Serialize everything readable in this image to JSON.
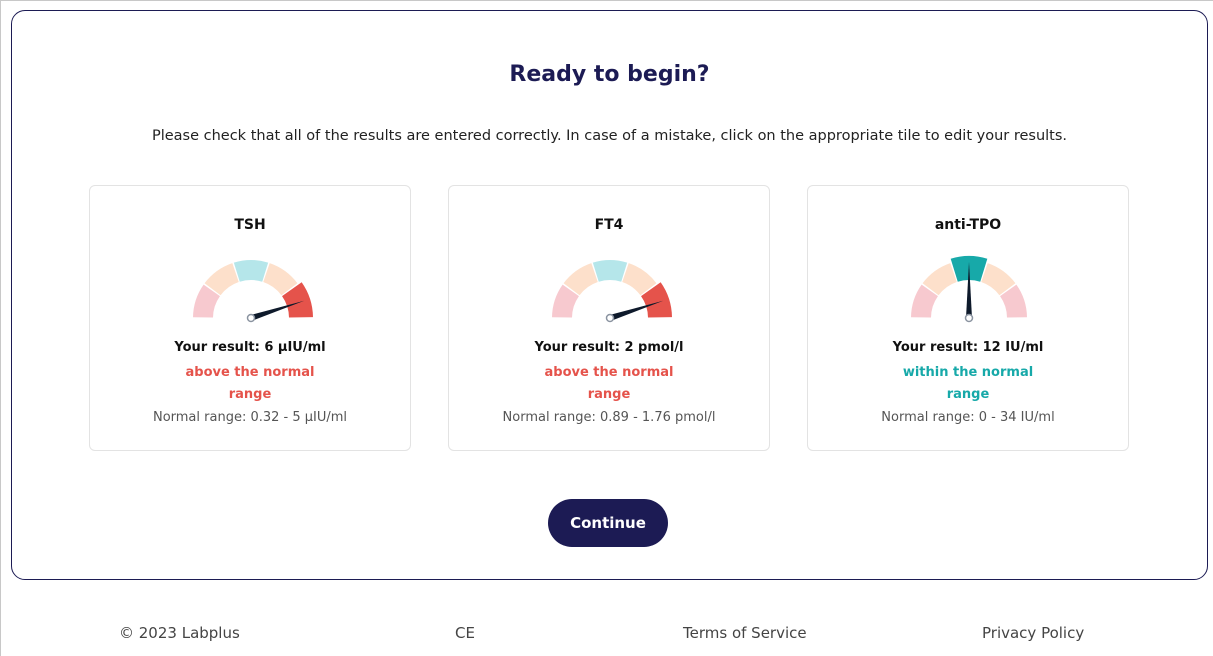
{
  "page": {
    "title": "Ready to begin?",
    "instructions": "Please check that all of the results are entered correctly. In case of a mistake, click on the appropriate tile to edit your results."
  },
  "tiles": [
    {
      "name": "TSH",
      "result_text": "Your result: 6 µIU/ml",
      "status_text": "above the normal range",
      "status_color": "#e5534b",
      "range_text": "Normal range: 0.32 - 5 µIU/ml",
      "gauge_level": 0.9
    },
    {
      "name": "FT4",
      "result_text": "Your result: 2 pmol/l",
      "status_text": "above the normal range",
      "status_color": "#e5534b",
      "range_text": "Normal range: 0.89 - 1.76 pmol/l",
      "gauge_level": 0.9
    },
    {
      "name": "anti-TPO",
      "result_text": "Your result: 12 IU/ml",
      "status_text": "within the normal range",
      "status_color": "#17a9a9",
      "range_text": "Normal range: 0 - 34 IU/ml",
      "gauge_level": 0.5
    }
  ],
  "continue_label": "Continue",
  "footer": {
    "copyright": "© 2023 Labplus",
    "ce": "CE",
    "terms": "Terms of Service",
    "privacy": "Privacy Policy"
  },
  "colors": {
    "primary": "#1c1b54",
    "above_range": "#e5534b",
    "within_range": "#17a9a9"
  }
}
